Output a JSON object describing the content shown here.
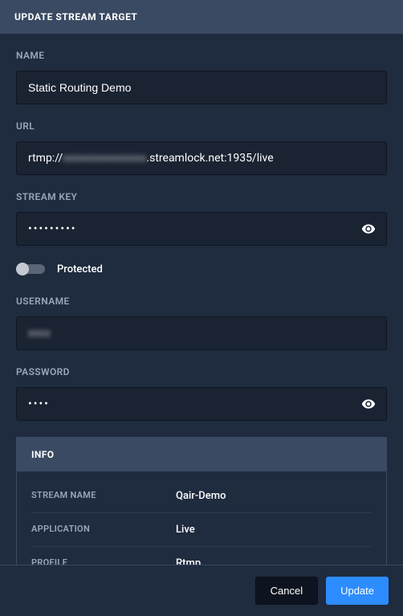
{
  "modal": {
    "title": "UPDATE STREAM TARGET"
  },
  "fields": {
    "name": {
      "label": "NAME",
      "value": "Static Routing Demo"
    },
    "url": {
      "label": "URL",
      "value_prefix": "rtmp://",
      "value_obscured": "xxxxxxxxxxxxxxx",
      "value_suffix": ".streamlock.net:1935/live"
    },
    "stream_key": {
      "label": "STREAM KEY",
      "value": "•••••••••"
    },
    "protected": {
      "label": "Protected",
      "enabled": false
    },
    "username": {
      "label": "USERNAME",
      "value_obscured": "xxxx"
    },
    "password": {
      "label": "PASSWORD",
      "value": "••••"
    }
  },
  "info": {
    "title": "INFO",
    "rows": [
      {
        "key": "STREAM NAME",
        "value": "Qair-Demo"
      },
      {
        "key": "APPLICATION",
        "value": "Live"
      },
      {
        "key": "PROFILE",
        "value": "Rtmp"
      }
    ]
  },
  "footer": {
    "cancel": "Cancel",
    "update": "Update"
  }
}
